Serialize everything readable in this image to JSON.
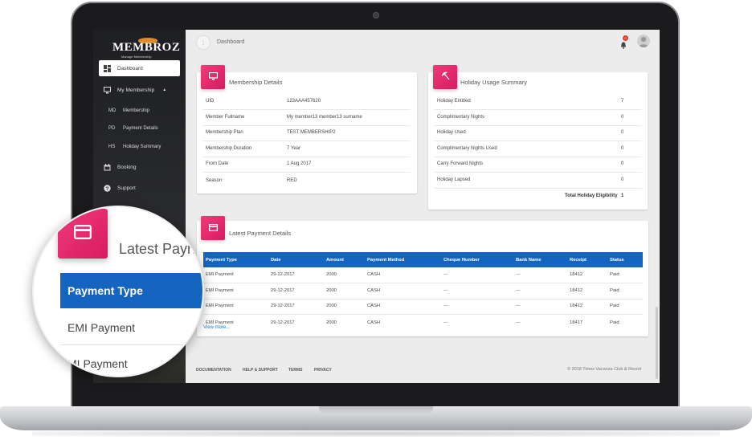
{
  "app": {
    "logo_text": "MEMBROZ",
    "logo_subtitle": "Manage Membership"
  },
  "colors": {
    "accent_pink": "#e91e63",
    "table_header_blue": "#1565c0",
    "sidebar_dark": "#242528"
  },
  "sidebar": {
    "items": [
      {
        "label": "Dashboard",
        "icon": "dashboard-icon"
      },
      {
        "label": "My Membership",
        "icon": "monitor-icon"
      },
      {
        "label": "Booking",
        "icon": "calendar-icon"
      },
      {
        "label": "Support",
        "icon": "help-icon"
      }
    ],
    "sub_items": [
      {
        "abbr": "MD",
        "label": "Membership"
      },
      {
        "abbr": "PD",
        "label": "Payment Details"
      },
      {
        "abbr": "HS",
        "label": "Holiday Summary"
      }
    ]
  },
  "topbar": {
    "breadcrumb": "Dashboard",
    "menu_button": "⋮",
    "notification_count": "0"
  },
  "membership_details": {
    "title": "Membership Details",
    "rows": [
      {
        "label": "UID",
        "value": "123AAA457620"
      },
      {
        "label": "Member Fullname",
        "value": "My member13 member13 surname"
      },
      {
        "label": "Membership Plan",
        "value": "TEST MEMBERSHIP2"
      },
      {
        "label": "Membership Duration",
        "value": "7 Year"
      },
      {
        "label": "From Date",
        "value": "1 Aug 2017"
      },
      {
        "label": "Season",
        "value": "RED"
      }
    ]
  },
  "holiday_summary": {
    "title": "Holiday Usage Summary",
    "rows": [
      {
        "label": "Holiday Entitled",
        "value": "7"
      },
      {
        "label": "Complimentary Nights",
        "value": "0"
      },
      {
        "label": "Holiday Used",
        "value": "0"
      },
      {
        "label": "Complimentary Nights Used",
        "value": "0"
      },
      {
        "label": "Carry Forward Nights",
        "value": "0"
      },
      {
        "label": "Holiday Lapsed",
        "value": "0"
      }
    ],
    "total_label": "Total Holiday Eligibility",
    "total_value": "1"
  },
  "payments": {
    "title": "Latest Payment Details",
    "columns": [
      "Payment Type",
      "Date",
      "Amount",
      "Payment Method",
      "Cheque Number",
      "Bank Name",
      "Receipt",
      "Status"
    ],
    "rows": [
      [
        "EMI Payment",
        "29-12-2017",
        "2000",
        "CASH",
        "---",
        "---",
        "18412",
        "Paid"
      ],
      [
        "EMI Payment",
        "29-12-2017",
        "2000",
        "CASH",
        "---",
        "---",
        "18412",
        "Paid"
      ],
      [
        "EMI Payment",
        "29-12-2017",
        "2000",
        "CASH",
        "---",
        "---",
        "18412",
        "Paid"
      ],
      [
        "EMI Payment",
        "29-12-2017",
        "2000",
        "CASH",
        "---",
        "---",
        "18417",
        "Paid"
      ]
    ],
    "view_more": "View more..."
  },
  "footer": {
    "links": [
      "DOCUMENTATION",
      "HELP & SUPPORT",
      "TERMS",
      "PRIVACY"
    ],
    "copyright": "© 2018 Times Vacanza Club & Resort"
  },
  "magnifier": {
    "title": "Latest Payn",
    "header": "Payment Type",
    "rows": [
      "EMI Payment",
      "MI Payment"
    ]
  }
}
